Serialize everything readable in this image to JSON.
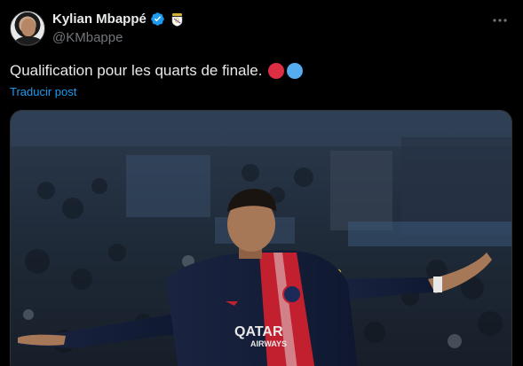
{
  "author": {
    "display_name": "Kylian Mbappé",
    "handle": "@KMbappe",
    "avatar": "profile-photo"
  },
  "icons": {
    "verified": "verified-badge-icon",
    "club": "real-madrid-crest-icon",
    "more": "more-options-icon"
  },
  "tweet": {
    "text": "Qualification pour les quarts de finale.",
    "emojis": [
      "red-circle",
      "blue-circle"
    ],
    "translate_label": "Traducir post"
  },
  "colors": {
    "background": "#000000",
    "text": "#e7e9ea",
    "muted": "#71767b",
    "link": "#1d9bf0",
    "verified": "#1d9bf0"
  }
}
